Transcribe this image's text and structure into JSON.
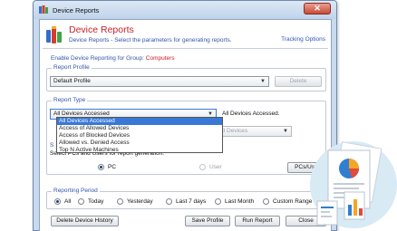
{
  "window": {
    "title": "Device Reports",
    "close_glyph": "✕"
  },
  "header": {
    "title": "Device Reports",
    "subtitle": "Device Reports - Select the parameters for generating reports.",
    "tracking_link": "Tracking Options"
  },
  "enable_text": "Enable Device Reporting for Group:",
  "group_name": "Computers",
  "report_profile": {
    "legend": "Report Profile",
    "selected": "Default Profile",
    "delete_label": "Delete"
  },
  "report_type": {
    "legend": "Report Type",
    "selected": "All Devices Accessed",
    "description": "All Devices Accessed.",
    "secondary_combo": "ed Devices",
    "options": [
      "All Devices Accessed",
      "Access of Allowed Devices",
      "Access of Blocked Devices",
      "Allowed vs. Denied Access",
      "Top N Active Machines"
    ]
  },
  "pcs_users": {
    "legend_fragment": "S",
    "hint": "Select PCs and Users for report generation.",
    "pc_label": "PC",
    "user_label": "User",
    "button_label": "PCs/User"
  },
  "period": {
    "legend": "Reporting Period",
    "options": [
      "All",
      "Today",
      "Yesterday",
      "Last 7 days",
      "Last Month",
      "Custom Range"
    ],
    "selected": "All"
  },
  "footer": {
    "delete_history": "Delete Device History",
    "save_profile": "Save Profile",
    "run_report": "Run Report",
    "close": "Close"
  },
  "icons": {
    "app": "device-report-icon",
    "header": "device-stack-icon",
    "art": "report-document-icon"
  },
  "colors": {
    "accent_red": "#c8202a",
    "link_blue": "#2a56b8",
    "selection_blue": "#3a78d6"
  }
}
